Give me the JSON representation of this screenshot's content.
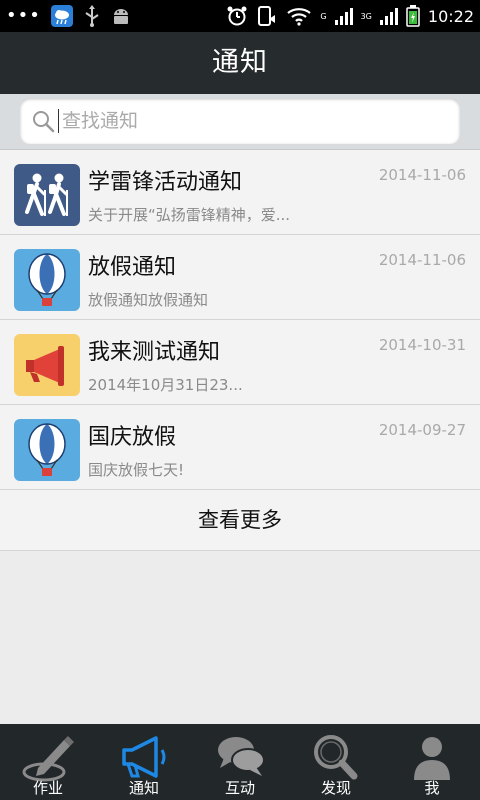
{
  "status_bar": {
    "time": "10:22",
    "network_labels": [
      "G",
      "3G"
    ]
  },
  "header": {
    "title": "通知"
  },
  "search": {
    "placeholder": "查找通知",
    "value": ""
  },
  "notifications": [
    {
      "title": "学雷锋活动通知",
      "date": "2014-11-06",
      "summary": "关于开展“弘扬雷锋精神，爱...",
      "icon": "hikers-icon",
      "icon_bg": "#3f5a86"
    },
    {
      "title": "放假通知",
      "date": "2014-11-06",
      "summary": "放假通知放假通知",
      "icon": "balloon-icon",
      "icon_bg": "#5aace0"
    },
    {
      "title": "我来测试通知",
      "date": "2014-10-31",
      "summary": "2014年10月31日23...",
      "icon": "megaphone-icon",
      "icon_bg": "#f7cf6b"
    },
    {
      "title": "国庆放假",
      "date": "2014-09-27",
      "summary": "国庆放假七天!",
      "icon": "balloon-icon",
      "icon_bg": "#5aace0"
    }
  ],
  "load_more_label": "查看更多",
  "tabs": [
    {
      "label": "作业",
      "icon": "pencil-icon",
      "active": false
    },
    {
      "label": "通知",
      "icon": "megaphone-icon",
      "active": true
    },
    {
      "label": "互动",
      "icon": "chat-bubbles-icon",
      "active": false
    },
    {
      "label": "发现",
      "icon": "magnifier-icon",
      "active": false
    },
    {
      "label": "我",
      "icon": "person-icon",
      "active": false
    }
  ],
  "colors": {
    "title_bar": "#262b2e",
    "tab_active": "#1e88e5",
    "tab_inactive": "#8a8a8a"
  }
}
